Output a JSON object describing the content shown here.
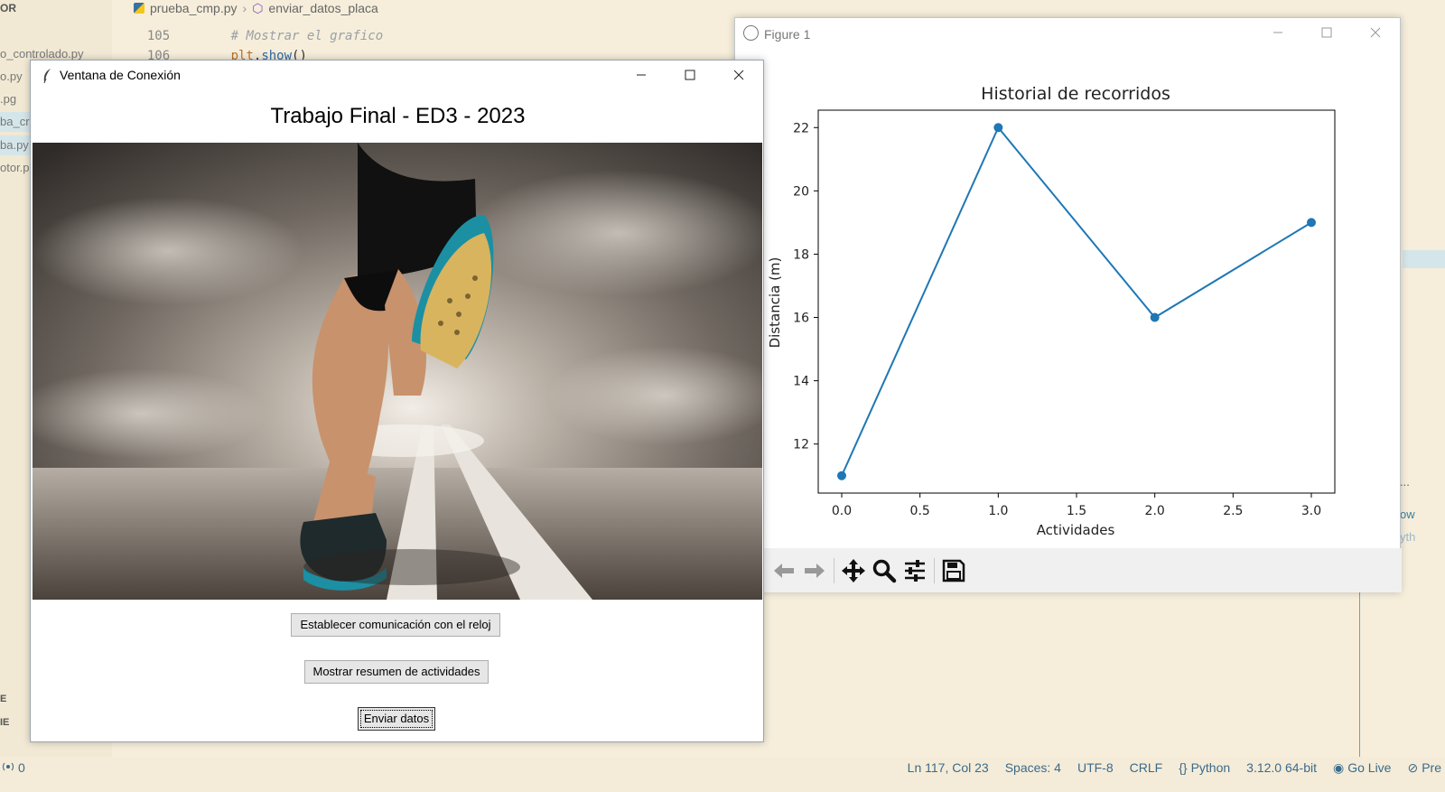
{
  "explorer": {
    "header": "OR",
    "files": [
      "o_controlado.py",
      "o.py",
      ".pg",
      "ba_cr",
      "ba.py",
      "otor.p"
    ],
    "section1": "E",
    "section2": "IE"
  },
  "editor": {
    "breadcrumb_file": "prueba_cmp.py",
    "breadcrumb_symbol": "enviar_datos_placa",
    "lines": [
      {
        "num": "105",
        "comment": "# Mostrar el grafico"
      },
      {
        "num": "106",
        "obj": "plt",
        "dot": ".",
        "fn": "show",
        "paren": "()"
      }
    ],
    "right_peek_1": "ow",
    "right_peek_2": "yth",
    "right_peek_3": "..."
  },
  "statusbar": {
    "left": "0",
    "position": "Ln 117, Col 23",
    "spaces": "Spaces: 4",
    "encoding": "UTF-8",
    "eol": "CRLF",
    "language": "Python",
    "interpreter": "3.12.0 64-bit",
    "golive": "Go Live",
    "prettier": "Pre"
  },
  "tk_window": {
    "title": "Ventana de Conexión",
    "heading": "Trabajo Final - ED3 - 2023",
    "buttons": {
      "connect": "Establecer comunicación con el reloj",
      "summary": "Mostrar resumen de actividades",
      "send": "Enviar datos"
    }
  },
  "figure_window": {
    "title": "Figure 1",
    "toolbar_icons": [
      "back-arrow-icon",
      "forward-arrow-icon",
      "pan-icon",
      "zoom-icon",
      "configure-subplots-icon",
      "save-icon"
    ]
  },
  "chart_data": {
    "type": "line",
    "title": "Historial de recorridos",
    "xlabel": "Actividades",
    "ylabel": "Distancia (m)",
    "x": [
      0,
      1,
      2,
      3
    ],
    "y": [
      11,
      22,
      16,
      19
    ],
    "xlim": [
      -0.15,
      3.15
    ],
    "ylim": [
      10.45,
      22.55
    ],
    "xticks": [
      "0.0",
      "0.5",
      "1.0",
      "1.5",
      "2.0",
      "2.5",
      "3.0"
    ],
    "yticks": [
      "12",
      "14",
      "16",
      "18",
      "20",
      "22"
    ],
    "marker": "circle",
    "color": "#1f77b4",
    "grid": false
  }
}
